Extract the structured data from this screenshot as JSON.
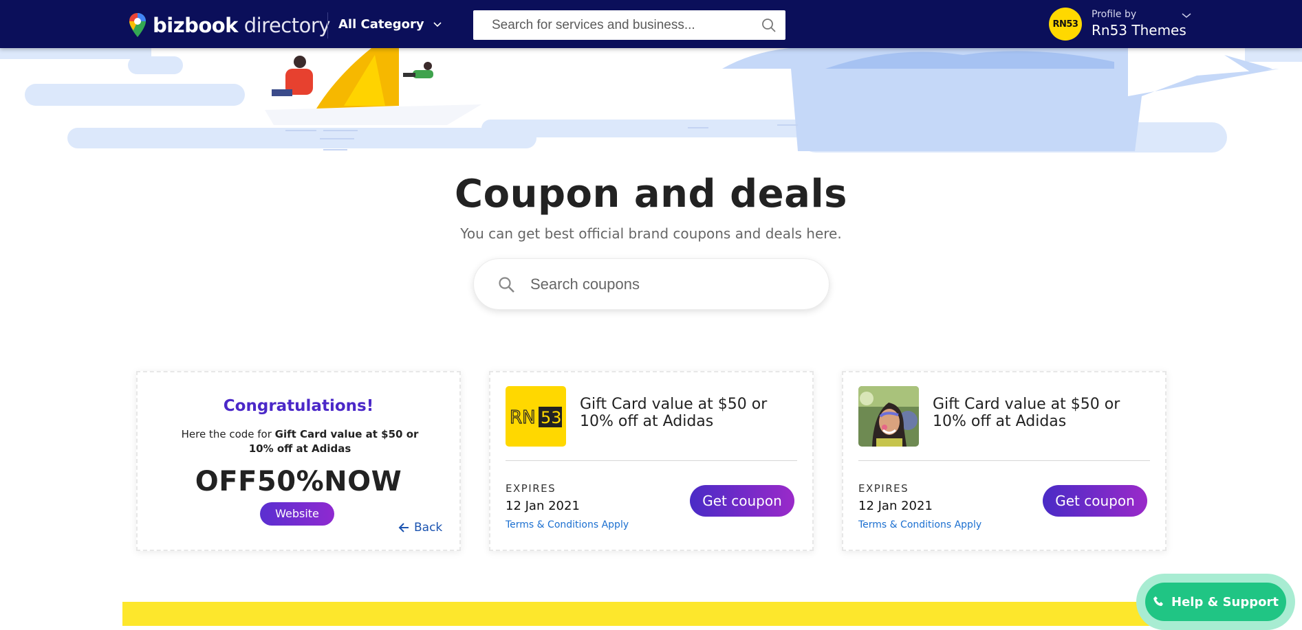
{
  "header": {
    "logo_bold": "bizbook",
    "logo_light": "directory",
    "category_label": "All Category",
    "search_placeholder": "Search for services and business...",
    "profile_by": "Profile by",
    "profile_name": "Rn53 Themes",
    "avatar_text": "RN53"
  },
  "main": {
    "title": "Coupon and deals",
    "subtitle": "You can get best official brand coupons and deals here.",
    "search_placeholder": "Search coupons"
  },
  "revealed_card": {
    "heading": "Congratulations!",
    "intro": "Here the code for",
    "deal_name": "Gift Card value at $50 or 10% off at Adidas",
    "code": "OFF50%NOW",
    "website_label": "Website",
    "back_label": "Back"
  },
  "coupons": [
    {
      "thumb_text": "RN53",
      "title": "Gift Card value at $50 or 10% off at Adidas",
      "expires_label": "EXPIRES",
      "expires_date": "12 Jan 2021",
      "terms": "Terms & Conditions Apply",
      "button": "Get coupon"
    },
    {
      "title": "Gift Card value at $50 or 10% off at Adidas",
      "expires_label": "EXPIRES",
      "expires_date": "12 Jan 2021",
      "terms": "Terms & Conditions Apply",
      "button": "Get coupon"
    }
  ],
  "help": {
    "label": "Help & Support"
  },
  "colors": {
    "navbar": "#0b0f5a",
    "accent_purple": "#4b28c8",
    "link_blue": "#1b6fd0",
    "help_green": "#20c584",
    "brand_yellow": "#ffd800"
  },
  "icons": [
    "map-pin-icon",
    "chevron-down-icon",
    "search-icon",
    "arrow-left-icon",
    "phone-icon"
  ]
}
